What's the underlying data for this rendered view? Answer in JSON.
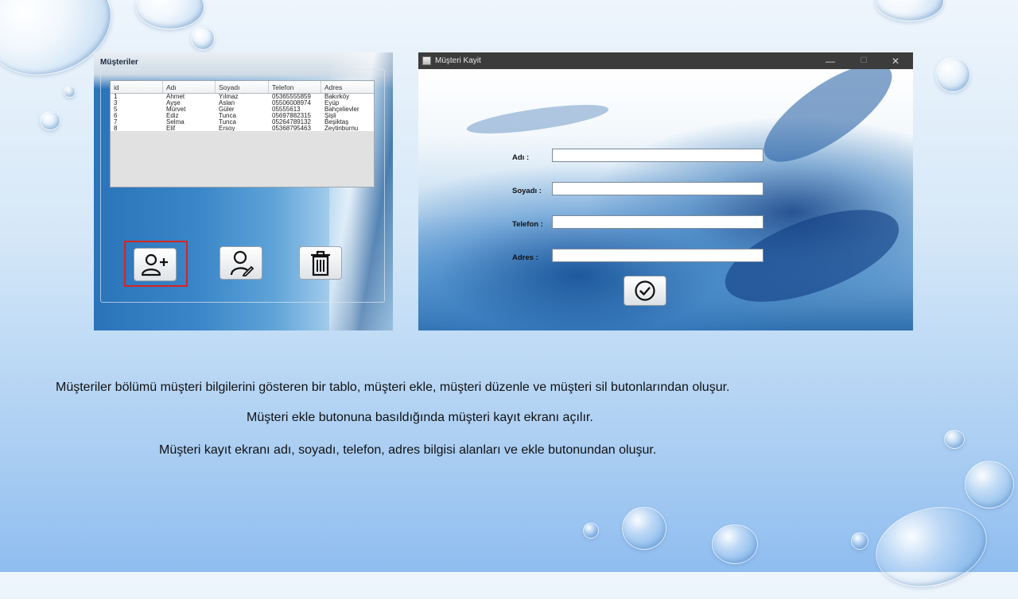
{
  "customers_window": {
    "title": "Müşteriler",
    "columns": [
      "id",
      "Adı",
      "Soyadı",
      "Telefon",
      "Adres"
    ],
    "rows": [
      [
        "1",
        "Ahmet",
        "Yılmaz",
        "05365555859",
        "Bakırköy"
      ],
      [
        "3",
        "Ayşe",
        "Aslan",
        "05506008974",
        "Eyüp"
      ],
      [
        "5",
        "Mürvet",
        "Güler",
        "05555613",
        "Bahçelievler"
      ],
      [
        "6",
        "Ediz",
        "Tunca",
        "05697882315",
        "Şişli"
      ],
      [
        "7",
        "Selma",
        "Tunca",
        "05264789132",
        "Beşiktaş"
      ],
      [
        "8",
        "Elif",
        "Ersoy",
        "05368795463",
        "Zeytinburnu"
      ]
    ],
    "buttons": {
      "add_icon": "add-user-icon",
      "edit_icon": "edit-user-icon",
      "delete_icon": "trash-icon"
    },
    "selected_button_color": "#d9231f"
  },
  "register_window": {
    "title": "Müşteri Kayit",
    "controls": {
      "minimize": "—",
      "maximize": "☐",
      "close": "✕"
    },
    "fields": {
      "name_label": "Adı :",
      "surname_label": "Soyadı :",
      "phone_label": "Telefon :",
      "address_label": "Adres :"
    },
    "submit_icon": "check-circle-icon"
  },
  "captions": [
    "Müşteriler bölümü müşteri bilgilerini gösteren bir tablo, müşteri ekle, müşteri düzenle ve müşteri sil butonlarından oluşur.",
    "Müşteri ekle butonuna basıldığında müşteri kayıt ekranı açılır.",
    "Müşteri kayıt ekranı adı, soyadı, telefon, adres bilgisi alanları ve ekle butonundan oluşur."
  ]
}
